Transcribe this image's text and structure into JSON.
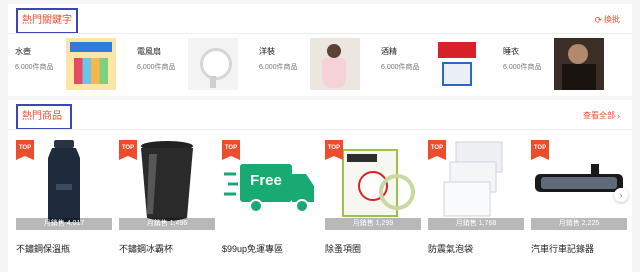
{
  "keywords_section": {
    "title": "熱門關鍵字",
    "action_label": "換批",
    "items": [
      {
        "name": "水壺",
        "count": "6,000件商品",
        "thumb_icon": "water-bottle-poster"
      },
      {
        "name": "電風扇",
        "count": "6,000件商品",
        "thumb_icon": "desk-fan"
      },
      {
        "name": "洋裝",
        "count": "6,000件商品",
        "thumb_icon": "dress-model"
      },
      {
        "name": "酒精",
        "count": "6,000件商品",
        "thumb_icon": "alcohol-sanitizer"
      },
      {
        "name": "睡衣",
        "count": "6,000件商品",
        "thumb_icon": "pajamas-model"
      }
    ]
  },
  "products_section": {
    "title": "熱門商品",
    "action_label": "查看全部",
    "badge_label": "TOP",
    "items": [
      {
        "name": "不鏽鋼保溫瓶",
        "sold": "月銷售 4,017",
        "icon": "thermos-bottle"
      },
      {
        "name": "不鏽鋼冰霸杯",
        "sold": "月銷售 1,496",
        "icon": "tumbler-cup"
      },
      {
        "name": "$99up免運專區",
        "sold": "",
        "icon": "free-shipping-truck",
        "promo_text": "Free"
      },
      {
        "name": "除蚤項圈",
        "sold": "月銷售 1,299",
        "icon": "flea-collar-package"
      },
      {
        "name": "防震氣泡袋",
        "sold": "月銷售 1,768",
        "icon": "bubble-bags"
      },
      {
        "name": "汽車行車記錄器",
        "sold": "月銷售 2,225",
        "icon": "dash-cam-mirror"
      }
    ]
  },
  "colors": {
    "accent": "#ee4d2d",
    "highlight_border": "#3b46b8",
    "truck_green": "#19a972"
  }
}
